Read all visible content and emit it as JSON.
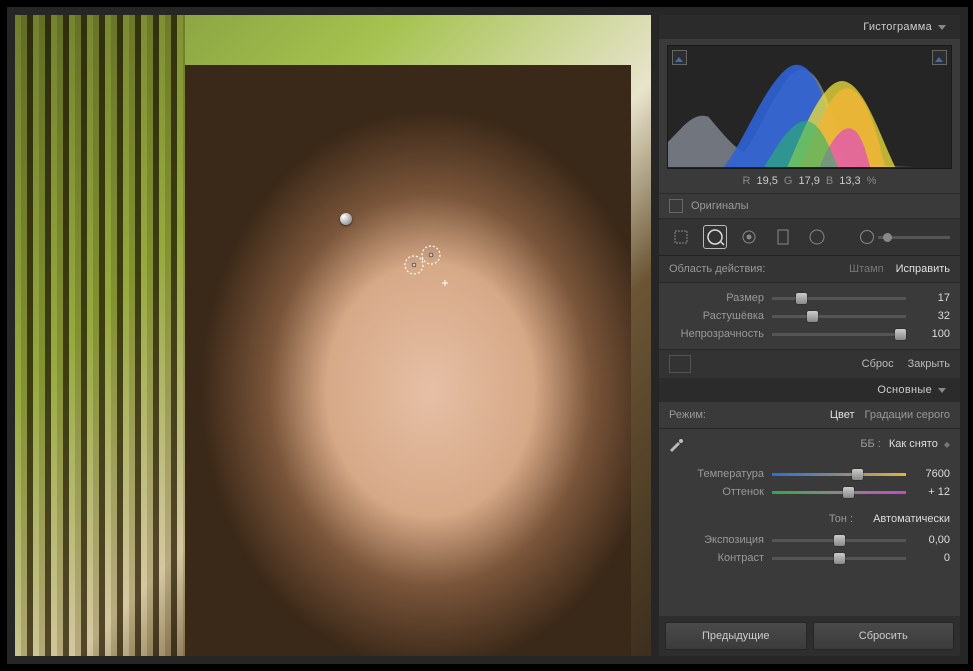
{
  "histogram_label": "Гистограмма",
  "rgb": {
    "r_lab": "R",
    "r": "19,5",
    "g_lab": "G",
    "g": "17,9",
    "b_lab": "B",
    "b": "13,3",
    "pct": "%"
  },
  "originals": "Оригиналы",
  "region": {
    "label": "Область действия:",
    "clone": "Штамп",
    "heal": "Исправить"
  },
  "sliders_heal": [
    {
      "label": "Размер",
      "value": "17",
      "pos": 20
    },
    {
      "label": "Растушёвка",
      "value": "32",
      "pos": 28
    },
    {
      "label": "Непрозрачность",
      "value": "100",
      "pos": 100
    }
  ],
  "reset": "Сброс",
  "close": "Закрыть",
  "basic_label": "Основные",
  "mode": {
    "label": "Режим:",
    "color": "Цвет",
    "gray": "Градации серого"
  },
  "wb": {
    "label": "ББ :",
    "value": "Как снято"
  },
  "sliders_wb": [
    {
      "label": "Температура",
      "value": "7600",
      "pos": 62,
      "grad": "temp"
    },
    {
      "label": "Оттенок",
      "value": "+ 12",
      "pos": 55,
      "grad": "tint"
    }
  ],
  "tone": {
    "label": "Тон :",
    "auto": "Автоматически"
  },
  "sliders_tone": [
    {
      "label": "Экспозиция",
      "value": "0,00",
      "pos": 50
    },
    {
      "label": "Контраст",
      "value": "0",
      "pos": 50
    }
  ],
  "footer": {
    "prev": "Предыдущие",
    "reset": "Сбросить"
  }
}
